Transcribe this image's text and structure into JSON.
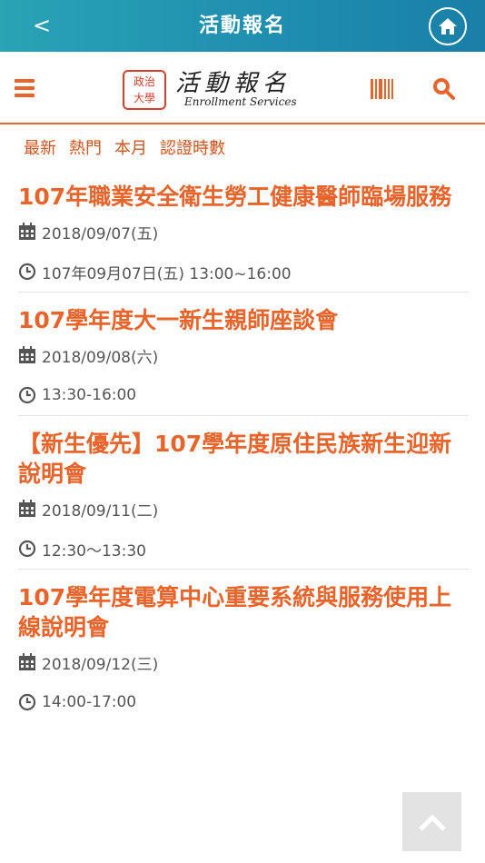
{
  "topbar": {
    "back_label": "<",
    "title": "活動報名",
    "home_icon": "home-icon"
  },
  "header": {
    "logo_seal_line1": "政治",
    "logo_seal_line2": "大學",
    "logo_cn": "活動報名",
    "logo_en": "Enrollment Services",
    "accent": "#e8642b"
  },
  "filters": [
    {
      "label": "最新"
    },
    {
      "label": "熱門"
    },
    {
      "label": "本月"
    },
    {
      "label": "認證時數"
    }
  ],
  "events": [
    {
      "title": "107年職業安全衛生勞工健康醫師臨場服務",
      "date": "2018/09/07(五)",
      "time": "107年09月07日(五) 13:00~16:00"
    },
    {
      "title": "107學年度大一新生親師座談會",
      "date": "2018/09/08(六)",
      "time": "13:30-16:00"
    },
    {
      "title": "【新生優先】107學年度原住民族新生迎新說明會",
      "date": "2018/09/11(二)",
      "time": "12:30～13:30"
    },
    {
      "title": "107學年度電算中心重要系統與服務使用上線說明會",
      "date": "2018/09/12(三)",
      "time": "14:00-17:00"
    }
  ]
}
